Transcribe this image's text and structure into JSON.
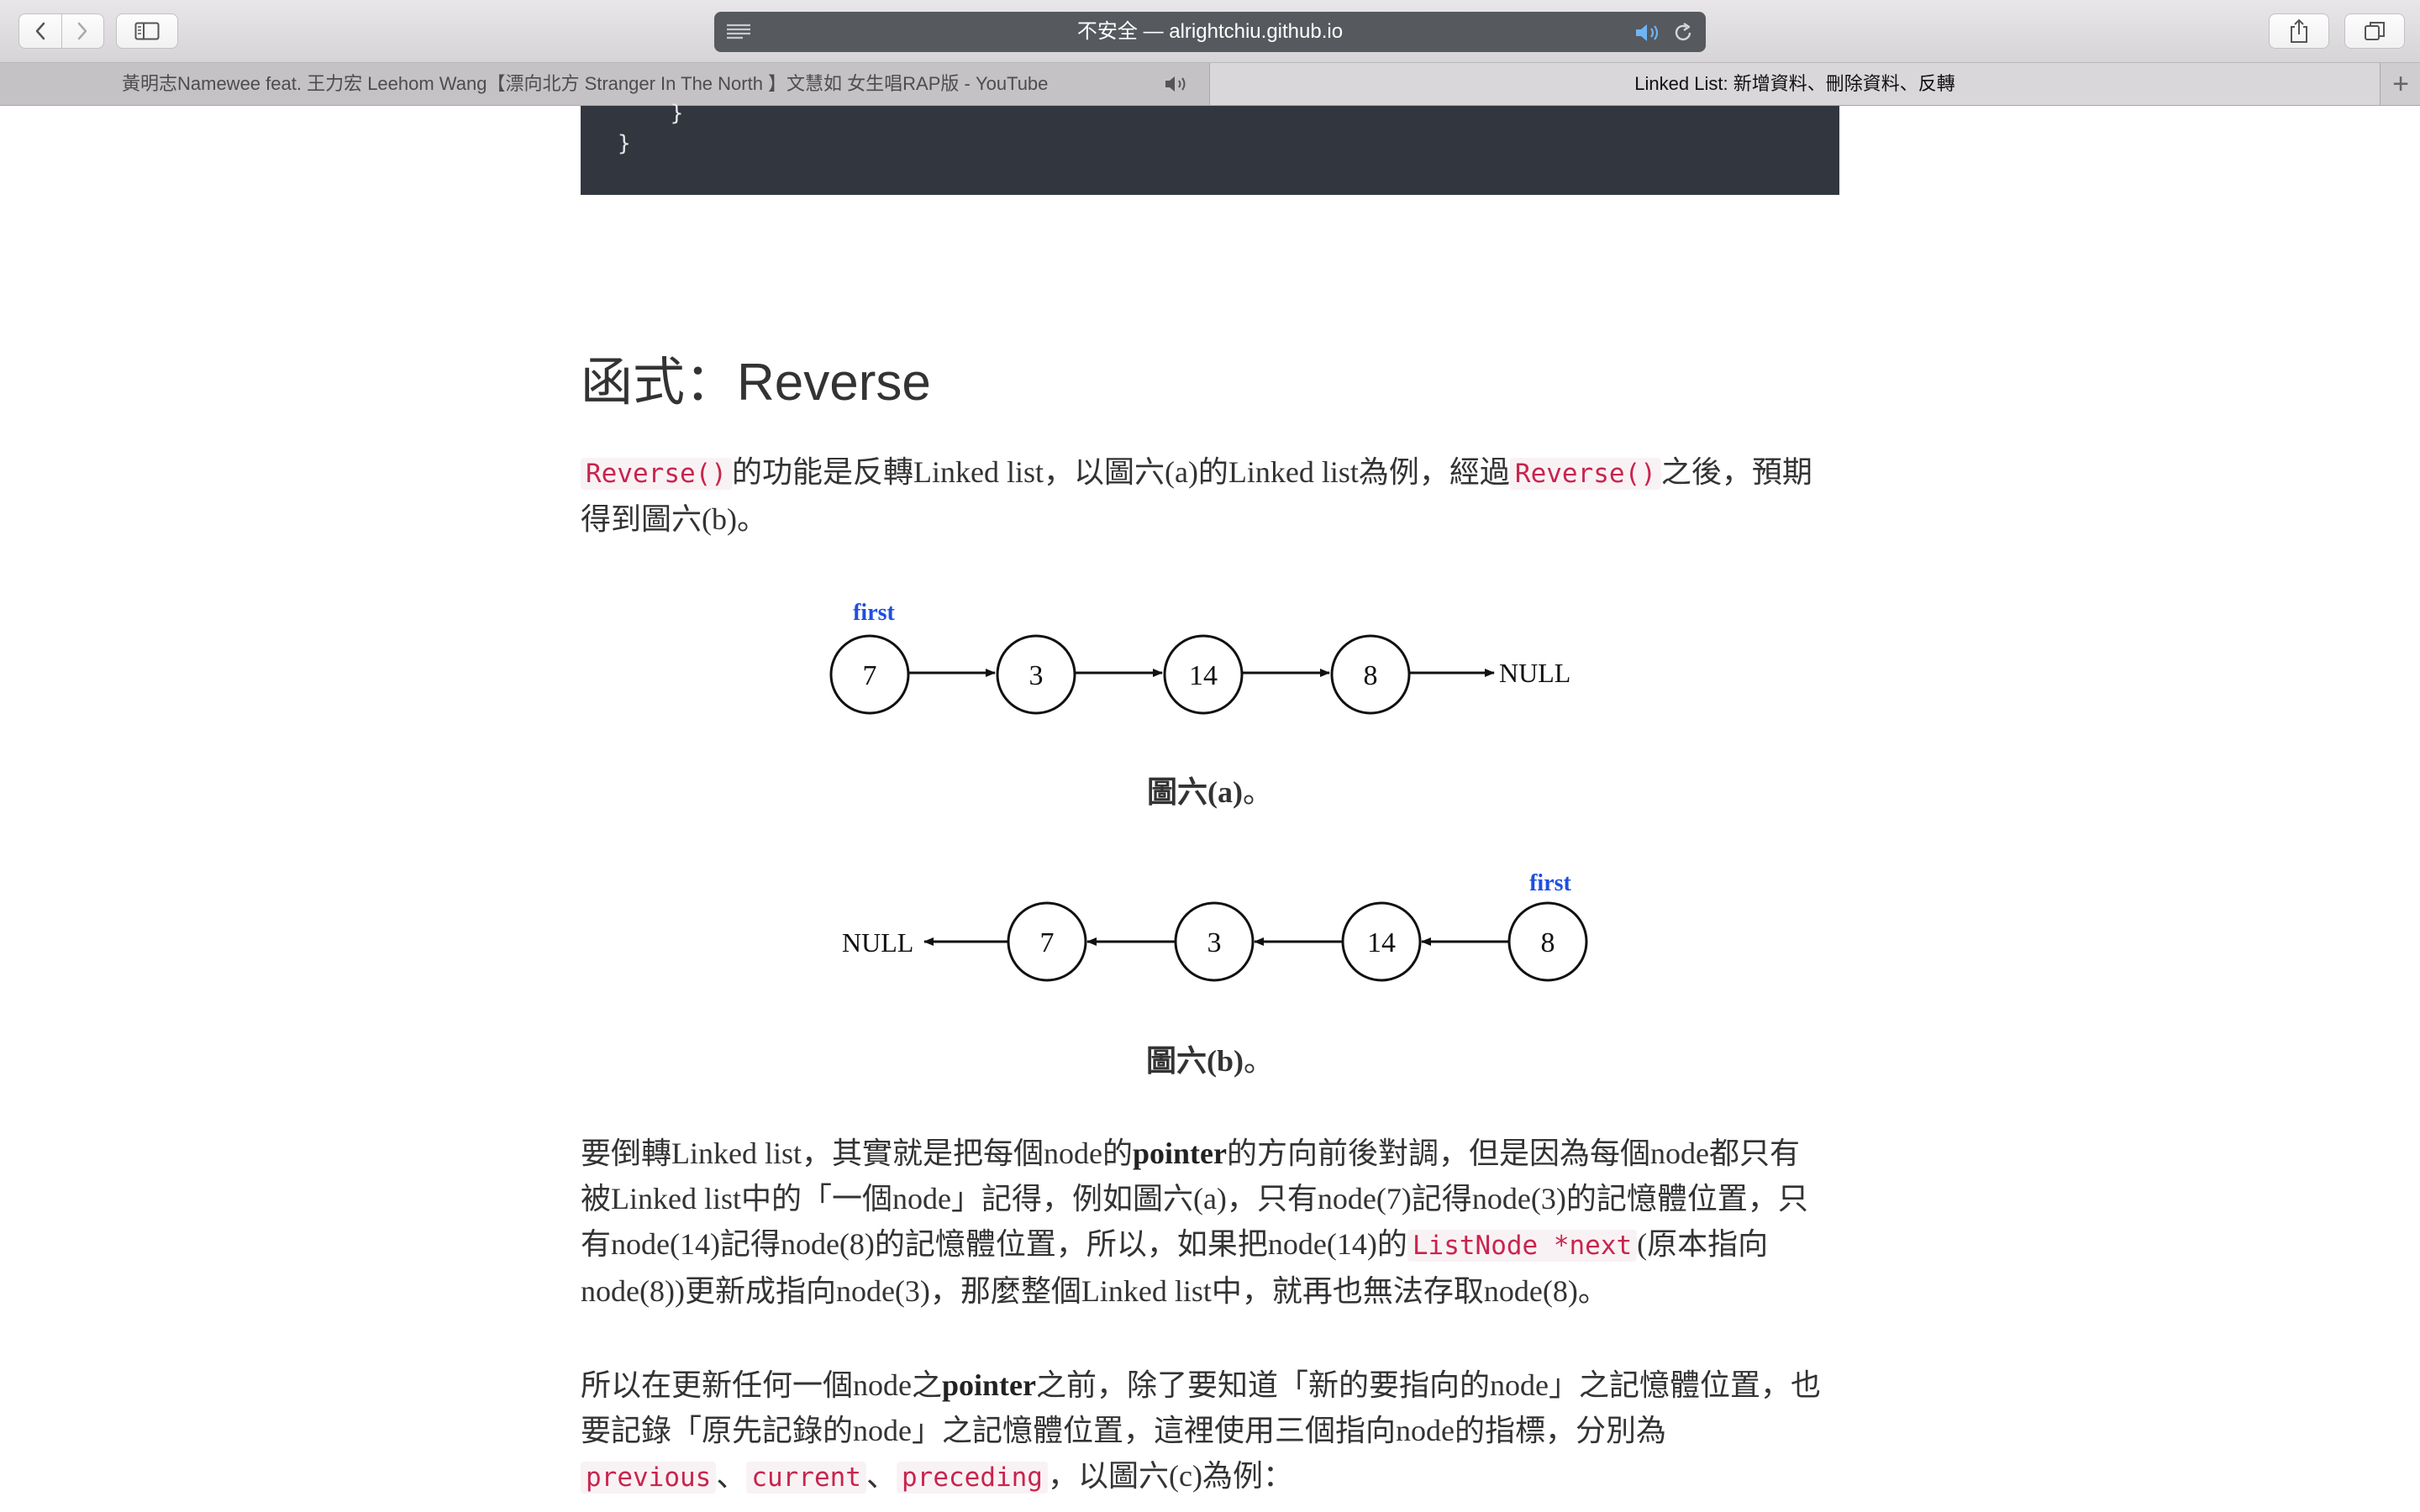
{
  "browser": {
    "address": "不安全 — alrightchiu.github.io",
    "tabs": [
      {
        "title": "黃明志Namewee feat. 王力宏 Leehom Wang【漂向北方 Stranger In The North 】文慧如 女生唱RAP版 - YouTube",
        "active": false,
        "playing_audio": true
      },
      {
        "title": "Linked List: 新增資料、刪除資料、反轉",
        "active": true
      }
    ],
    "new_tab_label": "+"
  },
  "code_tail": {
    "line1": "    }",
    "line2": "}"
  },
  "section": {
    "heading": "函式：Reverse"
  },
  "intro": {
    "code1": "Reverse()",
    "text1": "的功能是反轉Linked list，以圖六(a)的Linked list為例，經過",
    "code2": "Reverse()",
    "text2": "之後，預期得到圖六(b)。"
  },
  "figure_a": {
    "first_label": "first",
    "nodes": [
      "7",
      "3",
      "14",
      "8"
    ],
    "null_label": "NULL",
    "caption_bold": "圖六(a)",
    "caption_tail": "。"
  },
  "figure_b": {
    "first_label": "first",
    "nodes": [
      "7",
      "3",
      "14",
      "8"
    ],
    "null_label": "NULL",
    "caption_bold": "圖六(b)",
    "caption_tail": "。"
  },
  "para2": {
    "t1": "要倒轉Linked list，其實就是把每個node的",
    "bold": "pointer",
    "t2": "的方向前後對調，但是因為每個node都只有被Linked list中的「一個node」記得，例如圖六(a)，只有node(7)記得node(3)的記憶體位置，只有node(14)記得node(8)的記憶體位置，所以，如果把node(14)的",
    "code": "ListNode *next",
    "t3": "(原本指向node(8))更新成指向node(3)，那麼整個Linked list中，就再也無法存取node(8)。"
  },
  "para3": {
    "t1": "所以在更新任何一個node之",
    "bold": "pointer",
    "t2": "之前，除了要知道「新的要指向的node」之記憶體位置，也要記錄「原先記錄的node」之記憶體位置，這裡使用三個指向node的指標，分別為",
    "code1": "previous",
    "sep1": "、",
    "code2": "current",
    "sep2": "、",
    "code3": "preceding",
    "t3": "，以圖六(c)為例："
  },
  "colors": {
    "first_label": "#1f4fe0",
    "code_bg": "#32363f",
    "inline_code": "#c7254e",
    "address_bar": "#56595e"
  }
}
